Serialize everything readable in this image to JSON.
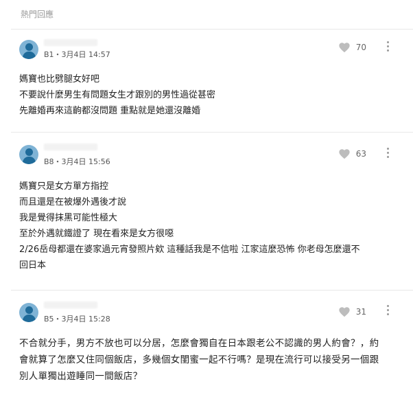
{
  "section": {
    "title": "熱門回應"
  },
  "comments": [
    {
      "floor_time": "B1・3月4日 14:57",
      "likes": "70",
      "lines": [
        "媽寶也比劈腿女好吧",
        "不要說什麼男生有問題女生才跟別的男性過從甚密",
        "先離婚再來這齣都沒問題 重點就是她還沒離婚"
      ]
    },
    {
      "floor_time": "B8・3月4日 15:56",
      "likes": "63",
      "lines": [
        "媽寶只是女方單方指控",
        "而且還是在被爆外遇後才說",
        "我是覺得抹黑可能性極大",
        "至於外遇就鐵證了 現在看來是女方很噁",
        "2/26岳母都還在婆家過元宵發照片欸 這種話我是不信啦 江家這麼恐怖 你老母怎麼還不",
        "回日本"
      ]
    },
    {
      "floor_time": "B5・3月4日 15:28",
      "likes": "31",
      "lines": [
        "不合就分手，男方不放也可以分居，怎麼會獨自在日本跟老公不認識的男人約會？，約",
        "會就算了怎麼又住同個飯店，多幾個女閨蜜一起不行嗎？是現在流行可以接受另一個跟",
        "別人單獨出遊睡同一間飯店？"
      ]
    }
  ]
}
